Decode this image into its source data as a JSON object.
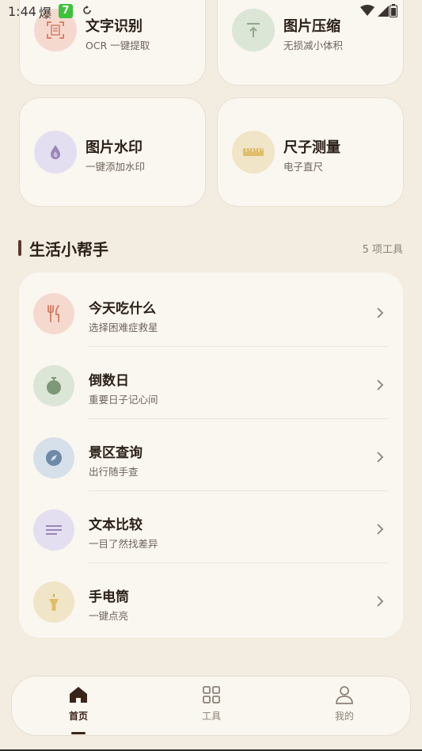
{
  "status_bar": {
    "time": "1:44",
    "notif_glyph": "爆",
    "green_badge": "7"
  },
  "tools_grid": [
    {
      "title": "文字识别",
      "subtitle": "OCR 一键提取",
      "icon": "ocr-scan-icon",
      "color": "#f5d9cf"
    },
    {
      "title": "图片压缩",
      "subtitle": "无损减小体积",
      "icon": "compress-icon",
      "color": "#dbe6d6"
    },
    {
      "title": "图片水印",
      "subtitle": "一键添加水印",
      "icon": "watermark-drop-icon",
      "color": "#e4dff0"
    },
    {
      "title": "尺子测量",
      "subtitle": "电子直尺",
      "icon": "ruler-icon",
      "color": "#f1e5c7"
    }
  ],
  "section": {
    "title": "生活小帮手",
    "count": "5 项工具"
  },
  "life_tools": [
    {
      "title": "今天吃什么",
      "subtitle": "选择困难症救星",
      "icon": "fork-knife-icon",
      "color": "#f5d9cf"
    },
    {
      "title": "倒数日",
      "subtitle": "重要日子记心间",
      "icon": "stopwatch-icon",
      "color": "#dbe6d6"
    },
    {
      "title": "景区查询",
      "subtitle": "出行随手查",
      "icon": "compass-icon",
      "color": "#d6e0ea"
    },
    {
      "title": "文本比较",
      "subtitle": "一目了然找差异",
      "icon": "text-lines-icon",
      "color": "#e4dff0"
    },
    {
      "title": "手电筒",
      "subtitle": "一键点亮",
      "icon": "flashlight-icon",
      "color": "#f1e5c7"
    }
  ],
  "bottom_nav": [
    {
      "label": "首页",
      "icon": "home-icon",
      "active": true
    },
    {
      "label": "工具",
      "icon": "grid-icon",
      "active": false
    },
    {
      "label": "我的",
      "icon": "person-icon",
      "active": false
    }
  ],
  "colors": {
    "background": "#f2ece1",
    "card": "#faf6f0",
    "accent": "#5b3a2a"
  }
}
